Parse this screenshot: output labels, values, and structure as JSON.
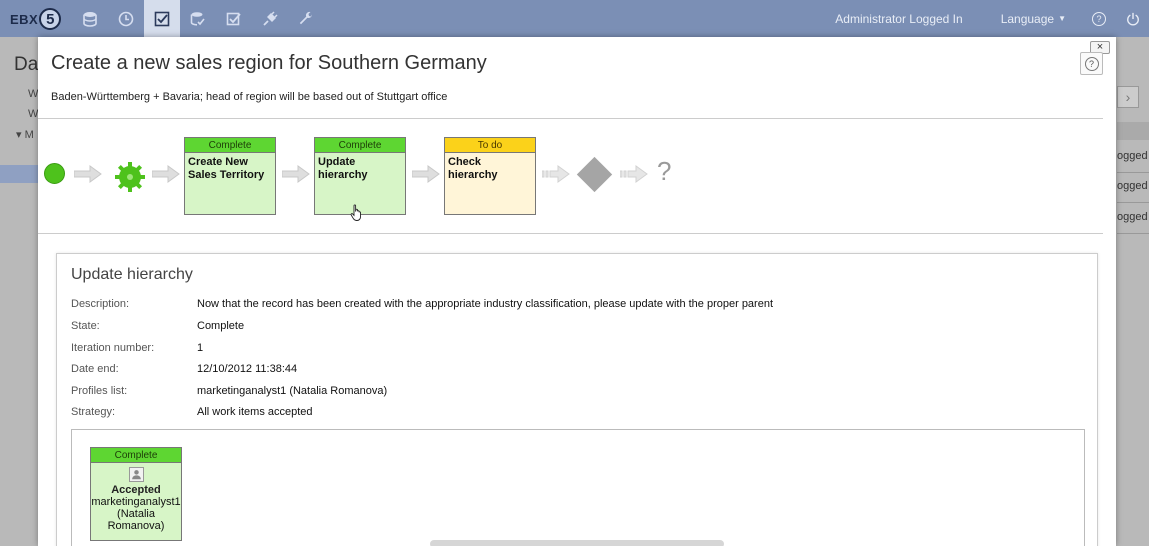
{
  "topbar": {
    "logo_text": "EBX",
    "logo_number": "5",
    "nav_icons": [
      "database-icon",
      "clock-icon",
      "checkbox-icon",
      "data-stack-icon",
      "checklist-icon",
      "plug-icon",
      "wrench-icon"
    ],
    "active_nav": "checkbox-icon",
    "admin_text": "Administrator Logged In",
    "language_label": "Language",
    "help_label": "?"
  },
  "background": {
    "title": "Da",
    "lines": [
      "W",
      "W",
      "M"
    ],
    "right_cells": [
      "ogged",
      "ogged",
      "ogged"
    ],
    "right_button": "›"
  },
  "modal": {
    "close_label": "×",
    "help_label": "?",
    "title": "Create a new sales region for Southern Germany",
    "subtitle": "Baden-Württemberg + Bavaria; head of region will be based out of Stuttgart office"
  },
  "workflow": {
    "steps": [
      {
        "state": "Complete",
        "label": "Create New Sales Territory"
      },
      {
        "state": "Complete",
        "label": "Update hierarchy"
      },
      {
        "state": "To do",
        "label": "Check hierarchy"
      }
    ],
    "end_symbol": "?"
  },
  "details": {
    "title": "Update hierarchy",
    "properties": [
      {
        "label": "Description:",
        "value": "Now that the record has been created with the appropriate industry classification, please update with the proper parent"
      },
      {
        "label": "State:",
        "value": "Complete"
      },
      {
        "label": "Iteration number:",
        "value": "1"
      },
      {
        "label": "Date end:",
        "value": "12/10/2012 11:38:44"
      },
      {
        "label": "Profiles list:",
        "value": "marketinganalyst1 (Natalia Romanova)"
      },
      {
        "label": "Strategy:",
        "value": "All work items accepted"
      }
    ],
    "work_item": {
      "state": "Complete",
      "status": "Accepted",
      "user_line1": "marketinganalyst1",
      "user_line2": "(Natalia",
      "user_line3": "Romanova)"
    }
  },
  "colors": {
    "topbar": "#7b8fb5",
    "complete_header": "#5ed632",
    "complete_body": "#d7f5c7",
    "todo_header": "#fbd21a",
    "todo_body": "#fff5d8"
  }
}
